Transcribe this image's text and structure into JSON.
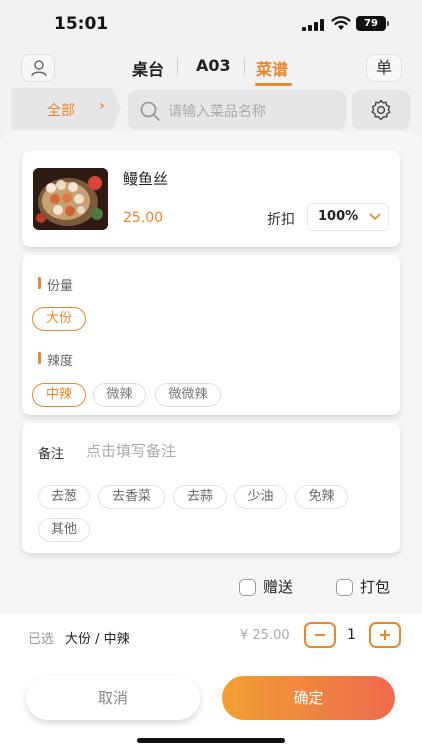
{
  "status": {
    "time": "15:01",
    "battery": "79"
  },
  "nav": {
    "tabs": [
      "桌台",
      "A03",
      "菜谱"
    ],
    "active_tab": "菜谱",
    "order_button": "单"
  },
  "filter": {
    "category": "全部",
    "search_placeholder": "请输入菜品名称"
  },
  "dish": {
    "name": "鳗鱼丝",
    "price": "25.00",
    "discount_label": "折扣",
    "discount_value": "100%"
  },
  "options": {
    "portion_title": "份量",
    "portion_items": [
      "大份"
    ],
    "spice_title": "辣度",
    "spice_items": [
      "中辣",
      "微辣",
      "微微辣"
    ]
  },
  "note": {
    "label": "备注",
    "placeholder": "点击填写备注",
    "tags": [
      "去葱",
      "去香菜",
      "去蒜",
      "少油",
      "免辣",
      "其他"
    ]
  },
  "extras": {
    "gift": "赠送",
    "takeaway": "打包"
  },
  "summary": {
    "selected_label": "已选",
    "selected_value": "大份 / 中辣",
    "total": "¥ 25.00",
    "quantity": "1"
  },
  "actions": {
    "cancel": "取消",
    "confirm": "确定"
  },
  "colors": {
    "accent": "#e8882e",
    "confirm_start": "#f1a032",
    "confirm_end": "#ee6a4e"
  }
}
